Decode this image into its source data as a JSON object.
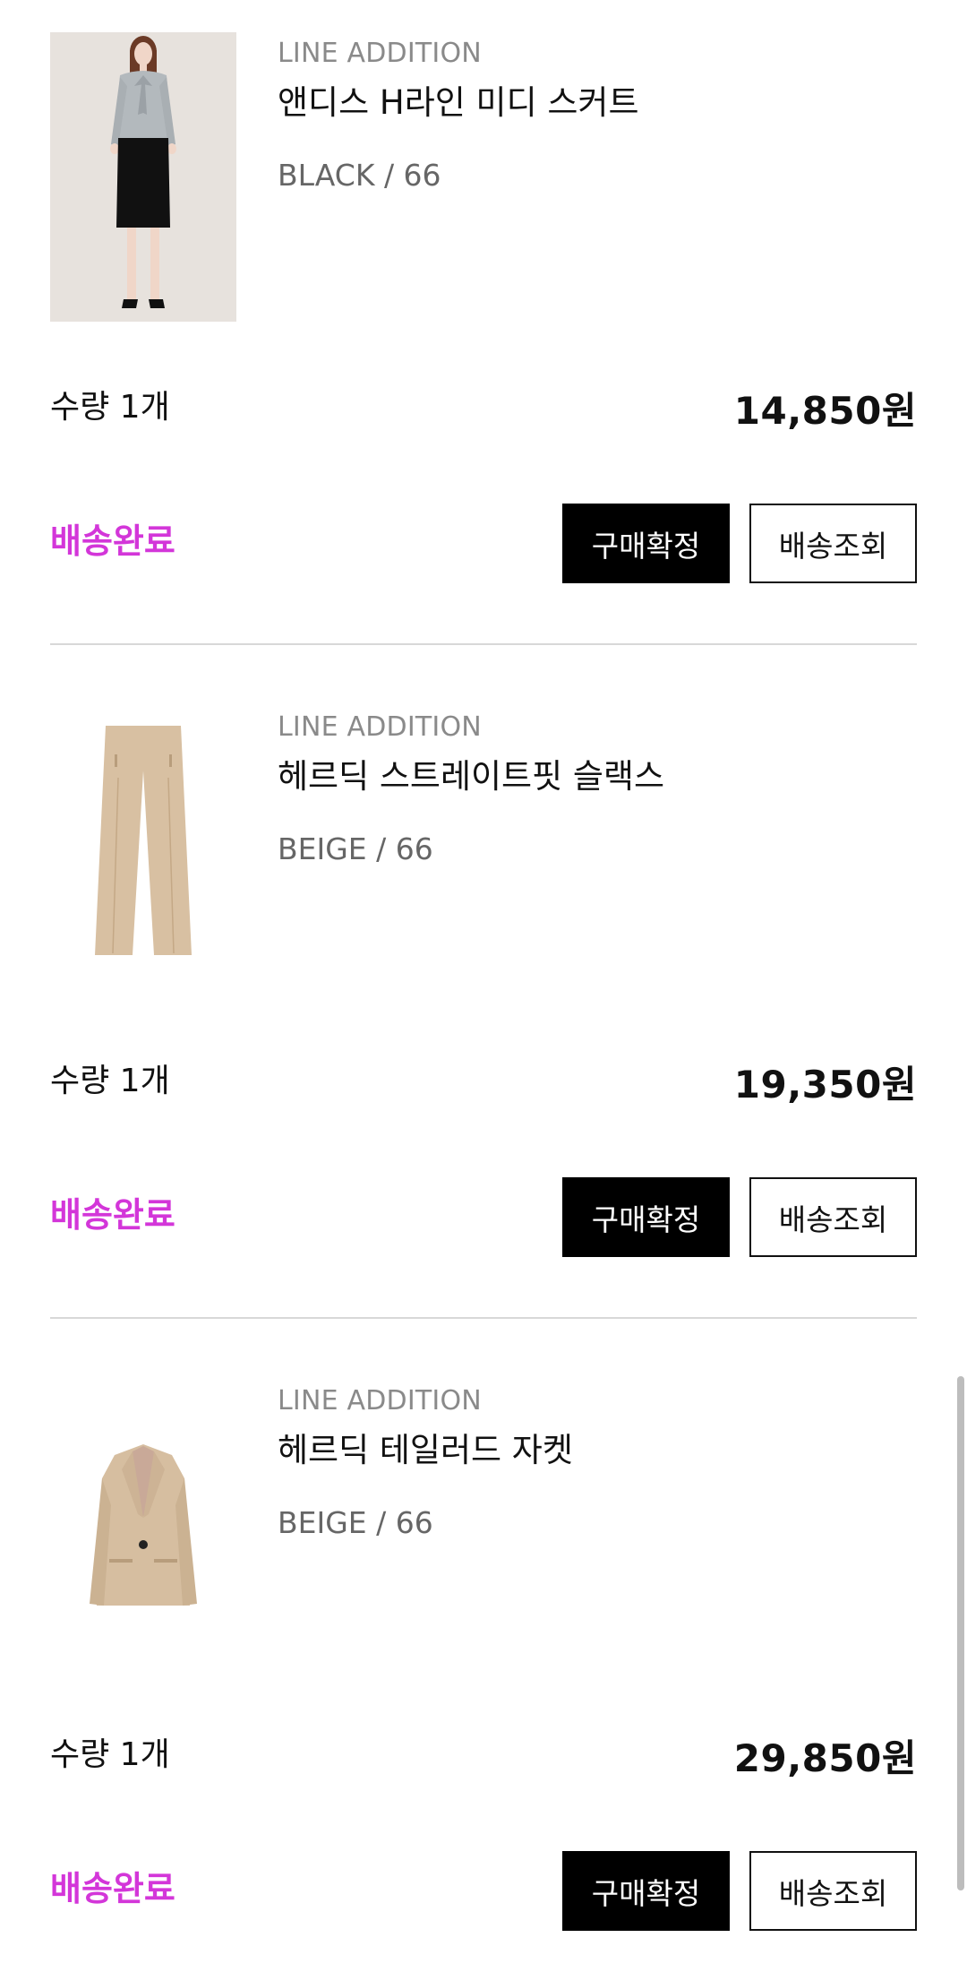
{
  "orders": [
    {
      "brand": "LINE ADDITION",
      "name": "앤디스 H라인 미디 스커트",
      "option": "BLACK / 66",
      "quantity": "수량 1개",
      "price": "14,850원",
      "status": "배송완료",
      "confirm_label": "구매확정",
      "track_label": "배송조회",
      "image": "model-skirt-photo"
    },
    {
      "brand": "LINE ADDITION",
      "name": "헤르딕 스트레이트핏 슬랙스",
      "option": "BEIGE / 66",
      "quantity": "수량 1개",
      "price": "19,350원",
      "status": "배송완료",
      "confirm_label": "구매확정",
      "track_label": "배송조회",
      "image": "beige-slacks-photo"
    },
    {
      "brand": "LINE ADDITION",
      "name": "헤르딕 테일러드 자켓",
      "option": "BEIGE / 66",
      "quantity": "수량 1개",
      "price": "29,850원",
      "status": "배송완료",
      "confirm_label": "구매확정",
      "track_label": "배송조회",
      "image": "beige-jacket-photo"
    }
  ],
  "colors": {
    "status": "#d336d9",
    "primary_button": "#000000",
    "divider": "#d8d8d8"
  }
}
